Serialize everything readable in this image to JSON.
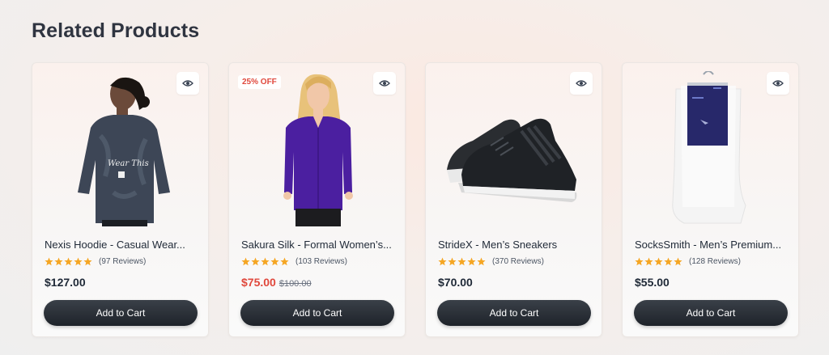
{
  "section": {
    "title": "Related Products"
  },
  "products": [
    {
      "name": "Nexis Hoodie - Casual Wear...",
      "reviews": "(97 Reviews)",
      "rating": 5,
      "price": "$127.00",
      "old_price": "",
      "badge": "",
      "cart_label": "Add to Cart",
      "image_icon": "hoodie-model-image",
      "print_text": "Wear This"
    },
    {
      "name": "Sakura Silk - Formal Women’s...",
      "reviews": "(103 Reviews)",
      "rating": 5,
      "price": "$75.00",
      "old_price": "$100.00",
      "badge": "25% OFF",
      "cart_label": "Add to Cart",
      "image_icon": "blouse-model-image"
    },
    {
      "name": "StrideX - Men’s Sneakers",
      "reviews": "(370 Reviews)",
      "rating": 5,
      "price": "$70.00",
      "old_price": "",
      "badge": "",
      "cart_label": "Add to Cart",
      "image_icon": "sneakers-image"
    },
    {
      "name": "SocksSmith - Men’s Premium...",
      "reviews": "(128 Reviews)",
      "rating": 5,
      "price": "$55.00",
      "old_price": "",
      "badge": "",
      "cart_label": "Add to Cart",
      "image_icon": "socks-image"
    }
  ],
  "colors": {
    "sale": "#e0483c",
    "star": "#f5a623",
    "button": "#24292f"
  }
}
